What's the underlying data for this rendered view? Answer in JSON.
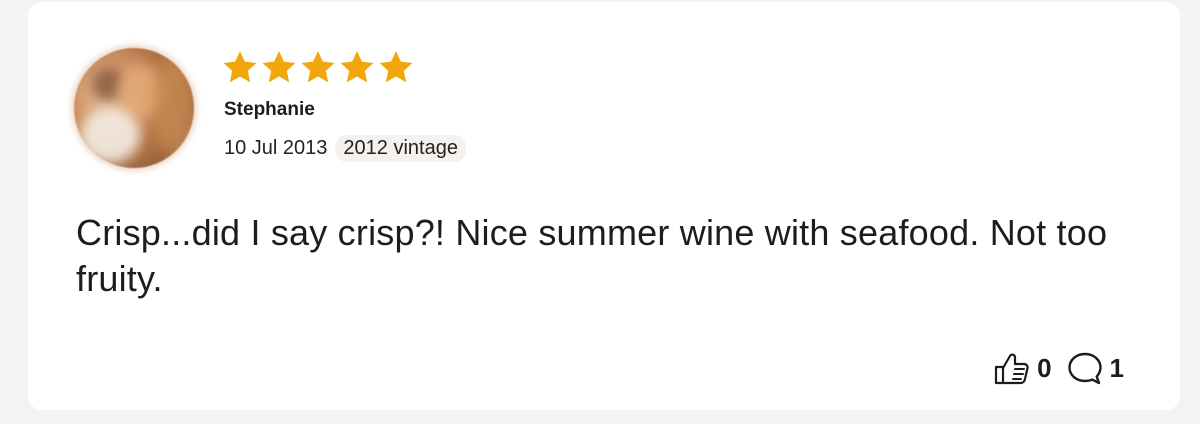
{
  "review": {
    "rating": 5,
    "max_rating": 5,
    "user_name": "Stephanie",
    "date": "10 Jul 2013",
    "vintage": "2012 vintage",
    "text": "Crisp...did I say crisp?! Nice summer wine with seafood. Not too fruity.",
    "likes": "0",
    "comments": "1"
  },
  "colors": {
    "star": "#f2a60c",
    "text": "#1d1d1f",
    "chip_bg": "#f5f1ee"
  },
  "icons": {
    "like": "thumbs-up-icon",
    "comment": "comment-bubble-icon",
    "star": "star-icon"
  }
}
